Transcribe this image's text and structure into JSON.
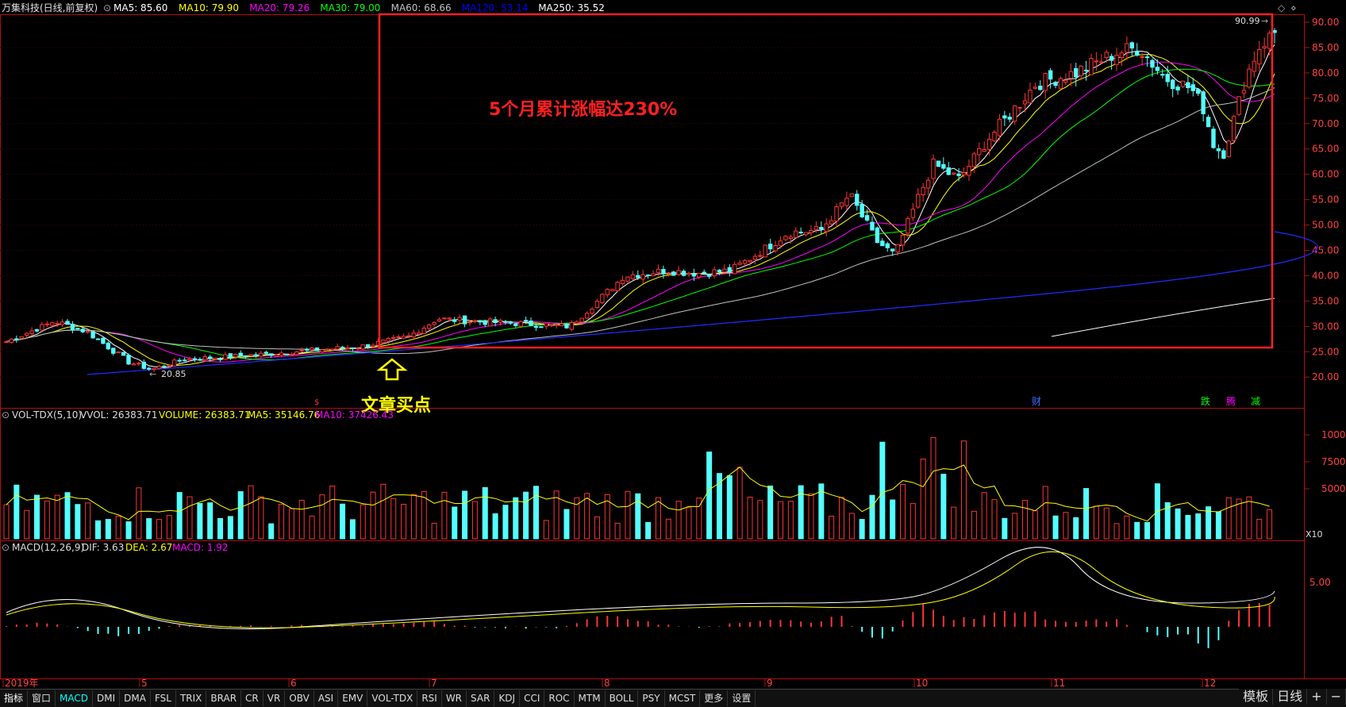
{
  "header": {
    "title": "万集科技(日线,前复权)",
    "ma": [
      {
        "label": "MA5: 85.60",
        "color": "#ffffff"
      },
      {
        "label": "MA10: 79.90",
        "color": "#ffff00"
      },
      {
        "label": "MA20: 79.26",
        "color": "#ff00ff"
      },
      {
        "label": "MA30: 79.00",
        "color": "#00ff00"
      },
      {
        "label": "MA60: 68.66",
        "color": "#c0c0c0"
      },
      {
        "label": "MA120: 53.14",
        "color": "#0000ff"
      },
      {
        "label": "MA250: 35.52",
        "color": "#ffffff"
      }
    ]
  },
  "annotations": {
    "headline": "5个月累计涨幅达230%",
    "buy_point": "文章买点",
    "high_label": "90.99",
    "low_label": "20.85",
    "event_cai": "财",
    "event_die": "跌",
    "event_teng": "腾",
    "event_jian": "减",
    "event_s": "$"
  },
  "price_axis": [
    "90.00",
    "85.00",
    "80.00",
    "75.00",
    "70.00",
    "65.00",
    "60.00",
    "55.00",
    "50.00",
    "45.00",
    "40.00",
    "35.00",
    "30.00",
    "25.00",
    "20.00"
  ],
  "volume_panel": {
    "title": "VOL-TDX(5,10)",
    "vvol": "VVOL: 26383.71",
    "volume": "VOLUME: 26383.71",
    "ma5": "MA5: 35146.76",
    "ma10": "MA10: 37426.43",
    "axis": [
      "10000",
      "7500",
      "5000"
    ],
    "unit": "X10"
  },
  "macd_panel": {
    "title": "MACD(12,26,9)",
    "dif": "DIF: 3.63",
    "dea": "DEA: 2.67",
    "macd": "MACD: 1.92",
    "axis": [
      "5.00"
    ]
  },
  "time_axis": [
    "2019年",
    "5",
    "6",
    "7",
    "8",
    "9",
    "10",
    "11",
    "12"
  ],
  "bottom_tabs": [
    "指标",
    "窗口",
    "MACD",
    "DMI",
    "DMA",
    "FSL",
    "TRIX",
    "BRAR",
    "CR",
    "VR",
    "OBV",
    "ASI",
    "EMV",
    "VOL-TDX",
    "RSI",
    "WR",
    "SAR",
    "KDJ",
    "CCI",
    "ROC",
    "MTM",
    "BOLL",
    "PSY",
    "MCST",
    "更多",
    "设置"
  ],
  "corner_tabs": [
    "模板",
    "日线",
    "+",
    "−"
  ],
  "colors": {
    "up": "#ff3333",
    "down": "#54ffff",
    "box": "#ff2020"
  }
}
